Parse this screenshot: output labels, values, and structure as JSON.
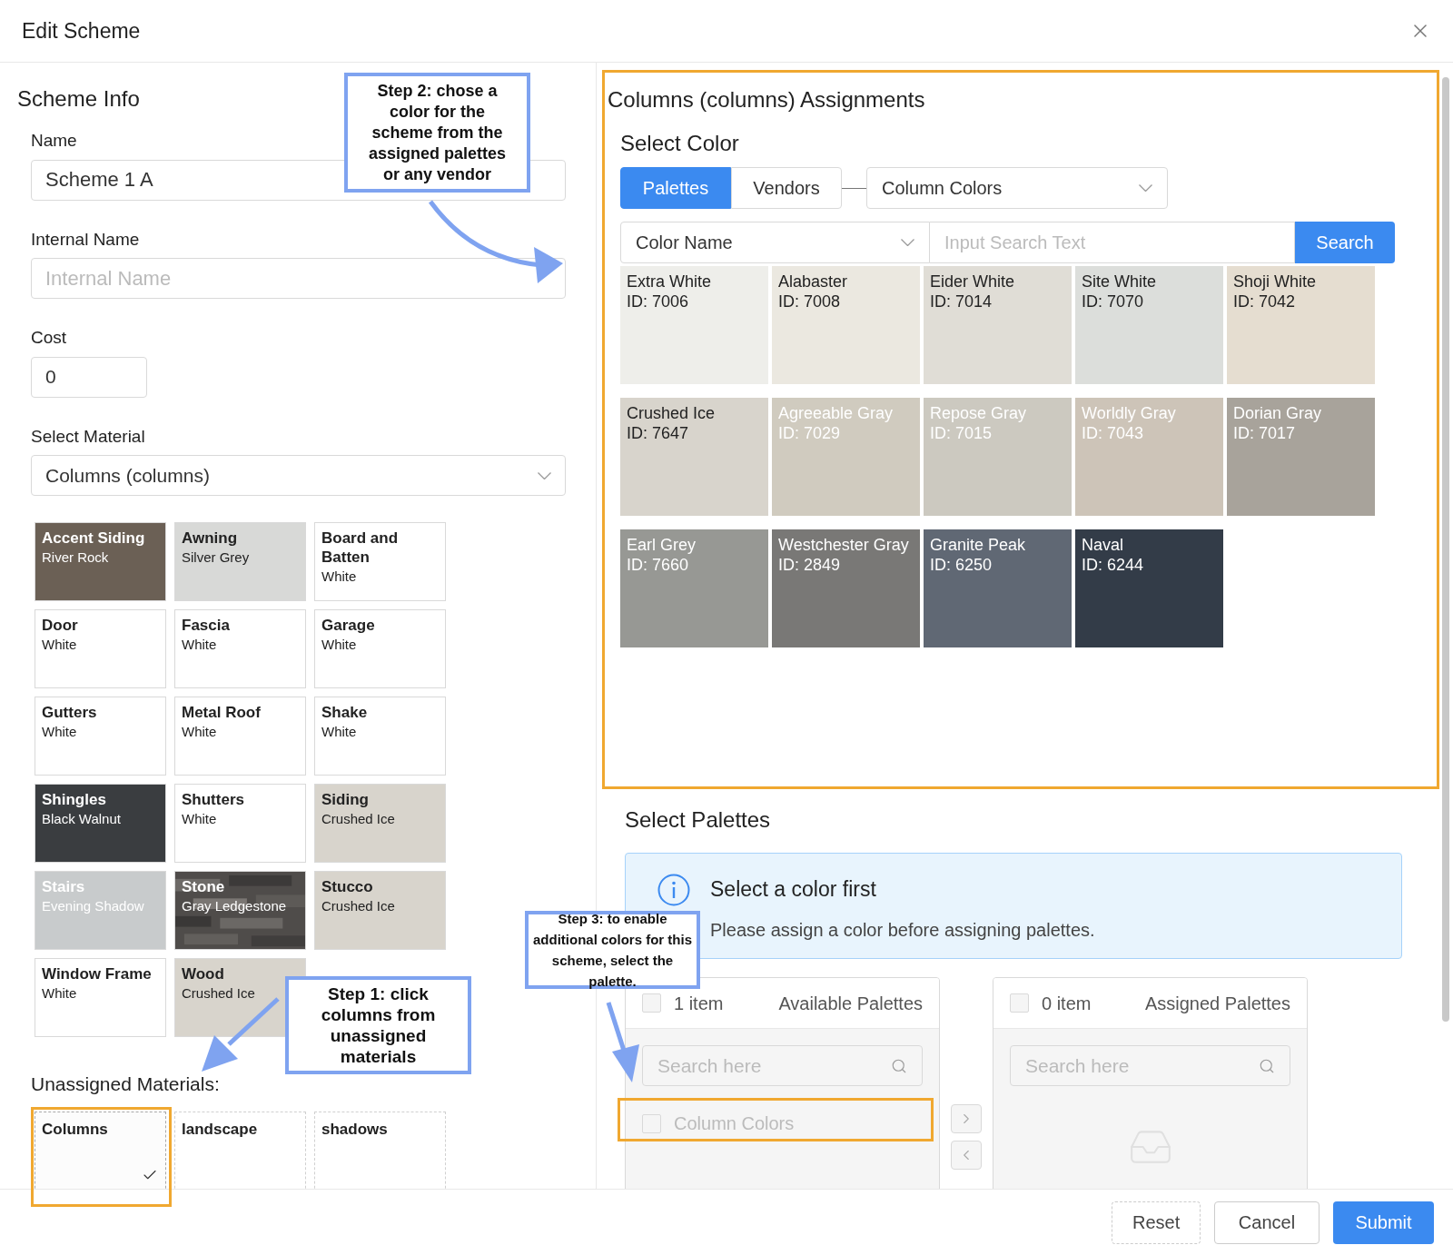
{
  "dialog": {
    "title": "Edit Scheme"
  },
  "scheme_info": {
    "heading": "Scheme Info",
    "fields": [
      {
        "label": "Name",
        "kind": "text",
        "value": "Scheme 1 A"
      },
      {
        "label": "Internal Name",
        "kind": "text",
        "placeholder": "Internal Name"
      },
      {
        "label": "Cost",
        "kind": "number",
        "value": "0"
      },
      {
        "label": "Select Material",
        "kind": "select",
        "value": "Columns (columns)"
      }
    ]
  },
  "materials": [
    {
      "name": "Accent Siding",
      "color_name": "River Rock",
      "color": "#6b6055"
    },
    {
      "name": "Awning",
      "color_name": "Silver Grey",
      "color": "#d8d9d7"
    },
    {
      "name": "Board and Batten",
      "color_name": "White",
      "color": "#ffffff"
    },
    {
      "name": "Door",
      "color_name": "White",
      "color": "#ffffff"
    },
    {
      "name": "Fascia",
      "color_name": "White",
      "color": "#ffffff"
    },
    {
      "name": "Garage",
      "color_name": "White",
      "color": "#ffffff"
    },
    {
      "name": "Gutters",
      "color_name": "White",
      "color": "#ffffff"
    },
    {
      "name": "Metal Roof",
      "color_name": "White",
      "color": "#ffffff"
    },
    {
      "name": "Shake",
      "color_name": "White",
      "color": "#ffffff"
    },
    {
      "name": "Shingles",
      "color_name": "Black Walnut",
      "color": "#3a3d40"
    },
    {
      "name": "Shutters",
      "color_name": "White",
      "color": "#ffffff"
    },
    {
      "name": "Siding",
      "color_name": "Crushed Ice",
      "color": "#d8d4cc"
    },
    {
      "name": "Stairs",
      "color_name": "Evening Shadow",
      "color": "#c8cbcc"
    },
    {
      "name": "Stone",
      "color_name": "Gray Ledgestone",
      "color": "#55524f",
      "kind": "texture"
    },
    {
      "name": "Stucco",
      "color_name": "Crushed Ice",
      "color": "#d8d4cc"
    },
    {
      "name": "Window Frame",
      "color_name": "White",
      "color": "#ffffff"
    },
    {
      "name": "Wood",
      "color_name": "Crushed Ice",
      "color": "#d8d4cc"
    }
  ],
  "unassigned": {
    "label": "Unassigned Materials:",
    "items": [
      {
        "name": "Columns",
        "selected": true
      },
      {
        "name": "landscape",
        "selected": false
      },
      {
        "name": "shadows",
        "selected": false
      }
    ]
  },
  "assignments": {
    "title": "Columns (columns) Assignments",
    "section": "Select Color",
    "tabs": [
      {
        "label": "Palettes",
        "selected": true
      },
      {
        "label": "Vendors",
        "selected": false
      }
    ],
    "palette_select": "Column Colors",
    "filter_select": "Color Name",
    "search_placeholder": "Input Search Text",
    "search_button": "Search",
    "swatches": [
      {
        "name": "Extra White",
        "id": "ID: 7006",
        "color": "#eeeeea"
      },
      {
        "name": "Alabaster",
        "id": "ID: 7008",
        "color": "#ebe8e0"
      },
      {
        "name": "Eider White",
        "id": "ID: 7014",
        "color": "#e0ddd6"
      },
      {
        "name": "Site White",
        "id": "ID: 7070",
        "color": "#dcdedb"
      },
      {
        "name": "Shoji White",
        "id": "ID: 7042",
        "color": "#e5ddd0"
      },
      {
        "name": "Crushed Ice",
        "id": "ID: 7647",
        "color": "#d8d4cc"
      },
      {
        "name": "Agreeable Gray",
        "id": "ID: 7029",
        "color": "#d0cbbf"
      },
      {
        "name": "Repose Gray",
        "id": "ID: 7015",
        "color": "#ccc9c0"
      },
      {
        "name": "Worldly Gray",
        "id": "ID: 7043",
        "color": "#cdc4b8"
      },
      {
        "name": "Dorian Gray",
        "id": "ID: 7017",
        "color": "#a8a39b"
      },
      {
        "name": "Earl Grey",
        "id": "ID: 7660",
        "color": "#979894"
      },
      {
        "name": "Westchester Gray",
        "id": "ID: 2849",
        "color": "#797876"
      },
      {
        "name": "Granite Peak",
        "id": "ID: 6250",
        "color": "#606874"
      },
      {
        "name": "Naval",
        "id": "ID: 6244",
        "color": "#333c48"
      }
    ]
  },
  "palettes": {
    "heading": "Select Palettes",
    "alert": {
      "title": "Select a color first",
      "message": "Please assign a color before assigning palettes."
    },
    "available": {
      "count": "1 item",
      "title": "Available Palettes",
      "checked": false,
      "search_placeholder": "Search here",
      "items": [
        {
          "label": "Column Colors",
          "checked": false,
          "disabled": true
        }
      ]
    },
    "assigned": {
      "count": "0 item",
      "title": "Assigned Palettes",
      "checked": false,
      "search_placeholder": "Search here"
    }
  },
  "footer": {
    "buttons": [
      {
        "label": "Reset",
        "kind": "dashed"
      },
      {
        "label": "Cancel",
        "kind": "default"
      },
      {
        "label": "Submit",
        "kind": "primary"
      }
    ]
  },
  "annotations": [
    {
      "text": "Step 2: chose a color for the scheme from the assigned palettes or any vendor"
    },
    {
      "text": "Step 1: click columns from unassigned materials"
    },
    {
      "text": "Step 3: to enable additional colors for this scheme, select the palette."
    }
  ]
}
